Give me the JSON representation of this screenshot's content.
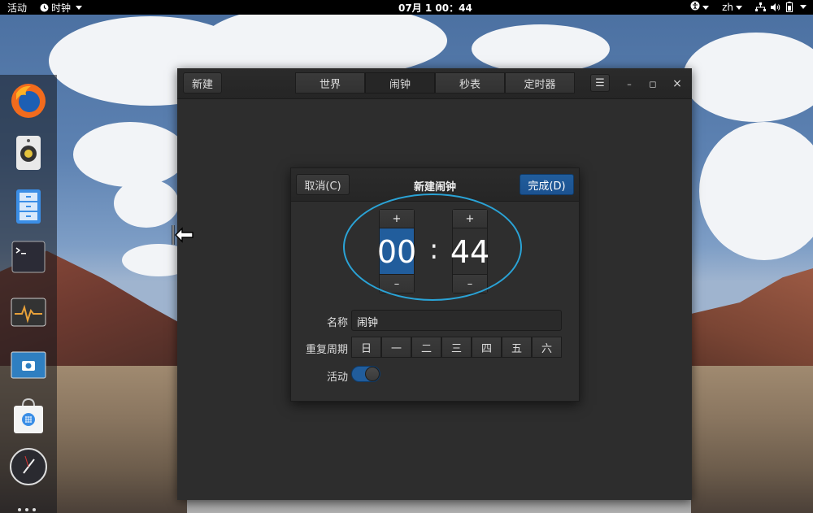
{
  "topbar": {
    "activities": "活动",
    "app_menu": "时钟",
    "clock": "07月 1  00：44",
    "lang": "zh"
  },
  "dock": {
    "items": [
      "firefox-icon",
      "speaker-icon",
      "files-icon",
      "terminal-icon",
      "system-monitor-icon",
      "screenshot-icon",
      "software-store-icon",
      "clock-icon"
    ]
  },
  "window": {
    "new_button": "新建",
    "tabs": [
      "世界",
      "闹钟",
      "秒表",
      "定时器"
    ],
    "active_tab": "闹钟",
    "menu_icon": "☰",
    "minimize": "–",
    "maximize": "◻",
    "close": "×"
  },
  "dialog": {
    "title": "新建闹钟",
    "cancel": "取消(C)",
    "done": "完成(D)",
    "hour": "00",
    "minute": "44",
    "plus": "+",
    "minus": "–",
    "separator": ":",
    "name_label": "名称",
    "name_value": "闹钟",
    "repeat_label": "重复周期",
    "days": [
      "日",
      "一",
      "二",
      "三",
      "四",
      "五",
      "六"
    ],
    "active_label": "活动",
    "active_on": true
  },
  "colors": {
    "accent": "#215d9c",
    "annotation_ring": "#2aa3d6"
  }
}
